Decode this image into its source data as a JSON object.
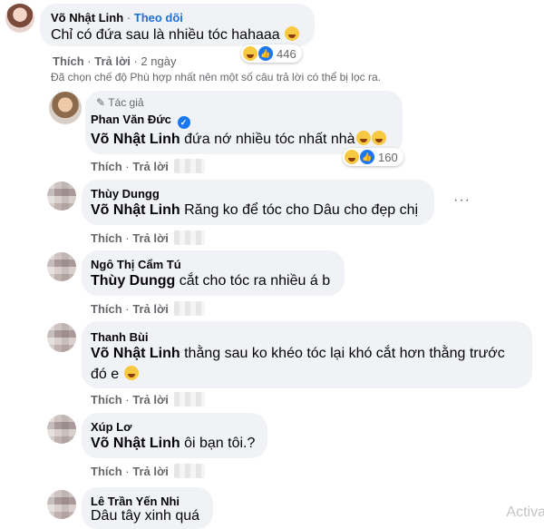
{
  "comments": [
    {
      "name": "Võ Nhật Linh",
      "follow_label": "Theo dõi",
      "text": "Chỉ có đứa sau là nhiều tóc hahaaa",
      "like_label": "Thích",
      "reply_label": "Trả lời",
      "time": "2 ngày",
      "reaction_count": "446"
    }
  ],
  "notice": "Đã chọn chế độ Phù hợp nhất nên một số câu trả lời có thể bị lọc ra.",
  "replies": [
    {
      "tag": "Tác giả",
      "name": "Phan Văn Đức",
      "mention": "Võ Nhật Linh",
      "text": "đứa nớ nhiều tóc nhất nhà",
      "like_label": "Thích",
      "reply_label": "Trả lời",
      "reaction_count": "160"
    },
    {
      "name": "Thùy Dungg",
      "mention": "Võ Nhật Linh",
      "text": "Răng ko để tóc cho Dâu cho đẹp chị",
      "like_label": "Thích",
      "reply_label": "Trả lời"
    },
    {
      "name": "Ngô Thị Cẩm Tú",
      "mention": "Thùy Dungg",
      "text": "cắt cho tóc ra nhiều á b",
      "like_label": "Thích",
      "reply_label": "Trả lời"
    },
    {
      "name": "Thanh Bùi",
      "mention": "Võ Nhật Linh",
      "text": "thằng sau ko khéo tóc lại khó cắt hơn thằng trước",
      "text2": "đó e",
      "like_label": "Thích",
      "reply_label": "Trả lời"
    },
    {
      "name": "Xúp Lơ",
      "mention": "Võ Nhật Linh",
      "text": "ôi bạn tôi.?",
      "like_label": "Thích",
      "reply_label": "Trả lời"
    },
    {
      "name": "Lê Trần Yến Nhi",
      "text": "Dâu tây xinh quá"
    }
  ],
  "more_label": "···",
  "watermark": "Activa",
  "icons": {
    "haha": "haha-icon",
    "like": "like-icon",
    "verified": "verified-icon"
  },
  "colors": {
    "bubble": "#f0f2f5",
    "link": "#216fdb",
    "secondary_text": "#65676b",
    "like_blue": "#1877f2",
    "emoji_yellow": "#f7c940"
  }
}
